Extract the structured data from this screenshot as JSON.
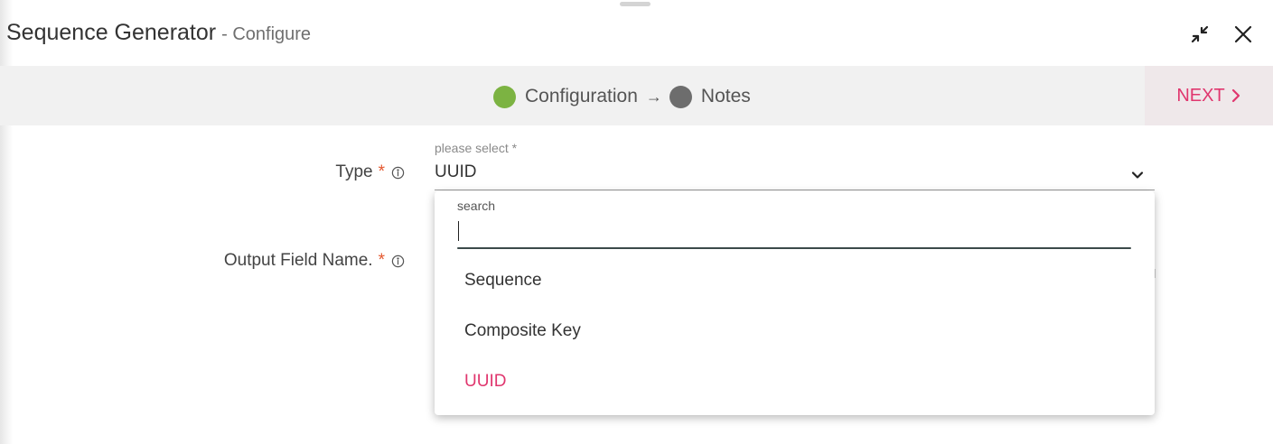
{
  "dialog": {
    "title": "Sequence Generator",
    "subtitle": "- Configure"
  },
  "header_icons": [
    "minimize-icon",
    "close-icon"
  ],
  "stepper": {
    "steps": [
      {
        "label": "Configuration",
        "state": "active",
        "color": "#7cb342"
      },
      {
        "label": "Notes",
        "state": "inactive",
        "color": "#6d6d6d"
      }
    ],
    "arrow": "→",
    "next_label": "NEXT"
  },
  "form": {
    "type": {
      "label": "Type",
      "required_mark": "*",
      "hint": "please select *",
      "value": "UUID"
    },
    "output_field": {
      "label": "Output Field Name.",
      "required_mark": "*"
    }
  },
  "dropdown": {
    "search_label": "search",
    "search_value": "",
    "options": [
      {
        "label": "Sequence",
        "selected": false
      },
      {
        "label": "Composite Key",
        "selected": false
      },
      {
        "label": "UUID",
        "selected": true
      }
    ]
  },
  "colors": {
    "accent": "#e0366e",
    "required": "#e4572e",
    "step_active": "#7cb342",
    "step_inactive": "#6d6d6d"
  }
}
